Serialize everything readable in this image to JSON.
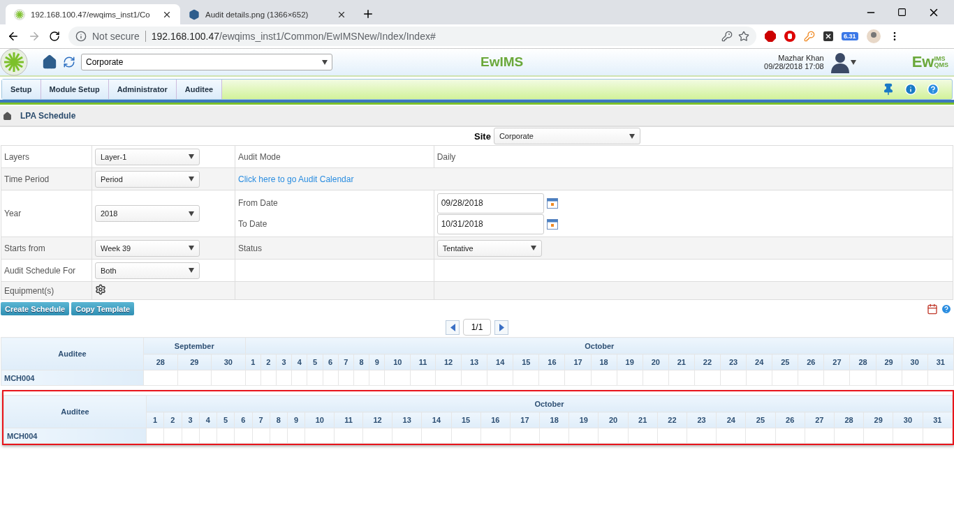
{
  "browser": {
    "tabs": [
      {
        "title": "192.168.100.47/ewqims_inst1/Co",
        "selected": true
      },
      {
        "title": "Audit details.png (1366×652)",
        "selected": false
      }
    ],
    "security": "Not secure",
    "url_host": "192.168.100.47",
    "url_path": "/ewqims_inst1/Common/EwIMSNew/Index/Index#",
    "extension_badge": "6.31"
  },
  "header": {
    "site_select": "Corporate",
    "logo": "EwIMS",
    "user_name": "Mazhar Khan",
    "datetime": "09/28/2018 17:08",
    "brand": {
      "main": "Ew",
      "top": "IMS",
      "bottom": "QMS"
    }
  },
  "menu": [
    {
      "label": "Setup",
      "selected": false
    },
    {
      "label": "Module Setup",
      "selected": false
    },
    {
      "label": "Administrator",
      "selected": false
    },
    {
      "label": "Auditee",
      "selected": false
    }
  ],
  "breadcrumb": "LPA Schedule",
  "site": {
    "label": "Site",
    "value": "Corporate"
  },
  "form_rows": [
    {
      "label": "Layers",
      "control": {
        "kind": "select",
        "value": "Layer-1"
      },
      "detail_label": "Audit Mode",
      "detail": {
        "kind": "text",
        "value": "Daily"
      }
    },
    {
      "label": "Time Period",
      "control": {
        "kind": "select",
        "value": "Period"
      },
      "detail": {
        "kind": "link",
        "value": "Click here to go Audit Calendar"
      }
    },
    {
      "label": "Year",
      "control": {
        "kind": "select",
        "value": "2018"
      },
      "detail": {
        "kind": "dates",
        "fields": [
          {
            "label": "From Date",
            "value": "09/28/2018"
          },
          {
            "label": "To Date",
            "value": "10/31/2018"
          }
        ]
      }
    },
    {
      "label": "Starts from",
      "control": {
        "kind": "select",
        "value": "Week 39"
      },
      "detail_label": "Status",
      "detail": {
        "kind": "select",
        "value": "Tentative"
      }
    },
    {
      "label": "Audit Schedule For",
      "control": {
        "kind": "select",
        "value": "Both"
      }
    },
    {
      "label": "Equipment(s)",
      "control": {
        "kind": "gear"
      }
    }
  ],
  "buttons": [
    "Create Schedule",
    "Copy Template"
  ],
  "pager": "1/1",
  "schedules": [
    {
      "highlighted": false,
      "header": "Auditee",
      "months": [
        {
          "name": "September",
          "days": [
            "28",
            "29",
            "30"
          ]
        },
        {
          "name": "October",
          "days": [
            "1",
            "2",
            "3",
            "4",
            "5",
            "6",
            "7",
            "8",
            "9",
            "10",
            "11",
            "12",
            "13",
            "14",
            "15",
            "16",
            "17",
            "18",
            "19",
            "20",
            "21",
            "22",
            "23",
            "24",
            "25",
            "26",
            "27",
            "28",
            "29",
            "30",
            "31"
          ]
        }
      ],
      "rows": [
        "MCH004"
      ]
    },
    {
      "highlighted": true,
      "header": "Auditee",
      "months": [
        {
          "name": "October",
          "days": [
            "1",
            "2",
            "3",
            "4",
            "5",
            "6",
            "7",
            "8",
            "9",
            "10",
            "11",
            "12",
            "13",
            "14",
            "15",
            "16",
            "17",
            "18",
            "19",
            "20",
            "21",
            "22",
            "23",
            "24",
            "25",
            "26",
            "27",
            "28",
            "29",
            "30",
            "31"
          ]
        }
      ],
      "rows": [
        "MCH004"
      ]
    }
  ]
}
